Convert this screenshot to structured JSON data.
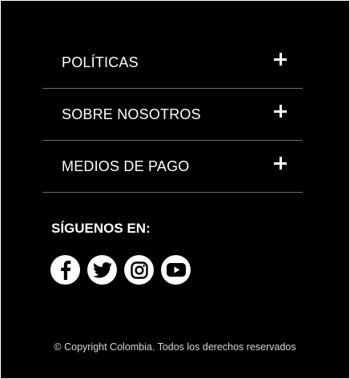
{
  "accordion": {
    "items": [
      {
        "label": "POLÍTICAS"
      },
      {
        "label": "SOBRE NOSOTROS"
      },
      {
        "label": "MEDIOS DE PAGO"
      }
    ]
  },
  "social": {
    "heading": "SÍGUENOS EN:",
    "icons": [
      "facebook-icon",
      "twitter-icon",
      "instagram-icon",
      "youtube-icon"
    ]
  },
  "footer": {
    "copyright": "© Copyright  Colombia. Todos los derechos reservados"
  },
  "colors": {
    "background": "#000000",
    "text": "#ffffff",
    "divider": "#6e6e6e"
  }
}
